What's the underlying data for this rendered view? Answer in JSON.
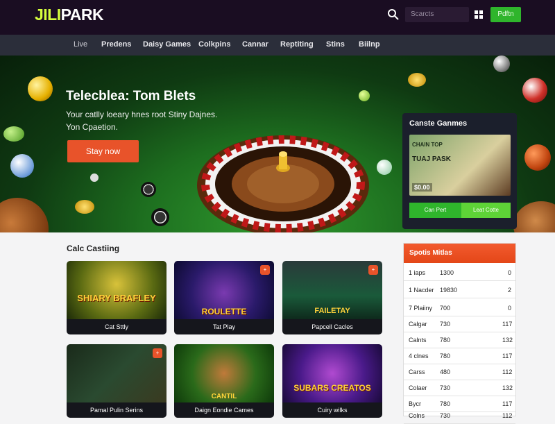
{
  "header": {
    "logo_part1": "JILI",
    "logo_part2": "PARK",
    "search_placeholder": "Scarcts",
    "join_label": "Pdftn"
  },
  "nav": {
    "items": [
      "Live",
      "Predens",
      "Daisy Games",
      "Colkpins",
      "Cannar",
      "Reptiting",
      "Stins",
      "Biilnp"
    ]
  },
  "hero": {
    "title": "Telecblea: Tom Blets",
    "subtitle": "Your catlly loeary hnes root Stiny Dajnes. Yon Cpaetion.",
    "cta_label": "Stay now"
  },
  "casino_panel": {
    "title": "Canste Ganmes",
    "img_line1": "CHAIN TOP",
    "img_line2": "TUAJ PASK",
    "img_price": "$0.00",
    "button1": "Can Pert",
    "button2": "Leat Cotte"
  },
  "section": {
    "title": "Calc Castiing"
  },
  "tiles": [
    {
      "label": "Cat Sttly",
      "art": "SHIARY BRAFLEY",
      "badge": ""
    },
    {
      "label": "Tat Play",
      "art": "ROULETTE",
      "badge": "+"
    },
    {
      "label": "Papcell Cacles",
      "art": "FAILETAY",
      "badge": "+"
    },
    {
      "label": "Pamal Pulin Serins",
      "art": "",
      "badge": "+"
    },
    {
      "label": "Daign Eondie Cames",
      "art": "CANTIL",
      "badge": ""
    },
    {
      "label": "Cuiry wilks",
      "art": "SUBARS CREATOS",
      "badge": ""
    }
  ],
  "sports": {
    "title": "Spotis Mitlas",
    "rows": [
      {
        "name": "1 iaps",
        "a": "1300",
        "b": "0"
      },
      {
        "name": "1 Nacder",
        "a": "19830",
        "b": "2"
      },
      {
        "name": "7 Plaiiny",
        "a": "700",
        "b": "0"
      },
      {
        "name": "Calgar",
        "a": "730",
        "b": "117"
      },
      {
        "name": "Calnts",
        "a": "780",
        "b": "132"
      },
      {
        "name": "4 clnes",
        "a": "780",
        "b": "117"
      },
      {
        "name": "Carss",
        "a": "480",
        "b": "112"
      },
      {
        "name": "Colaer",
        "a": "730",
        "b": "132"
      },
      {
        "name": "Bycr",
        "a": "780",
        "b": "117"
      },
      {
        "name": "Colns",
        "a": "730",
        "b": "112"
      }
    ]
  }
}
